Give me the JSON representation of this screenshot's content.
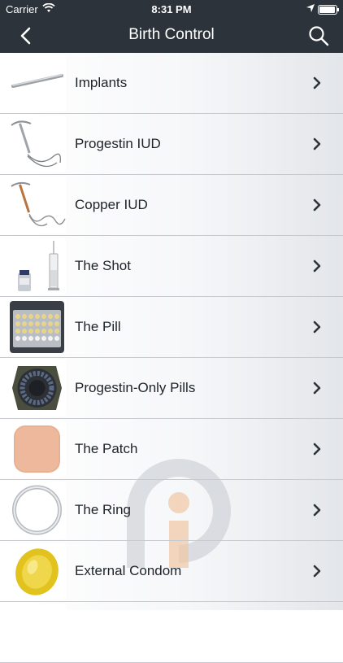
{
  "status_bar": {
    "carrier": "Carrier",
    "time": "8:31 PM"
  },
  "header": {
    "title": "Birth Control"
  },
  "items": [
    {
      "label": "Implants"
    },
    {
      "label": "Progestin IUD"
    },
    {
      "label": "Copper IUD"
    },
    {
      "label": "The Shot"
    },
    {
      "label": "The Pill"
    },
    {
      "label": "Progestin-Only Pills"
    },
    {
      "label": "The Patch"
    },
    {
      "label": "The Ring"
    },
    {
      "label": "External Condom"
    }
  ],
  "colors": {
    "nav_background": "#2c333a",
    "text": "#1d2329",
    "chevron": "#2c333a",
    "watermark_gray": "#c8ccd2",
    "watermark_orange": "#f0c6a3"
  }
}
